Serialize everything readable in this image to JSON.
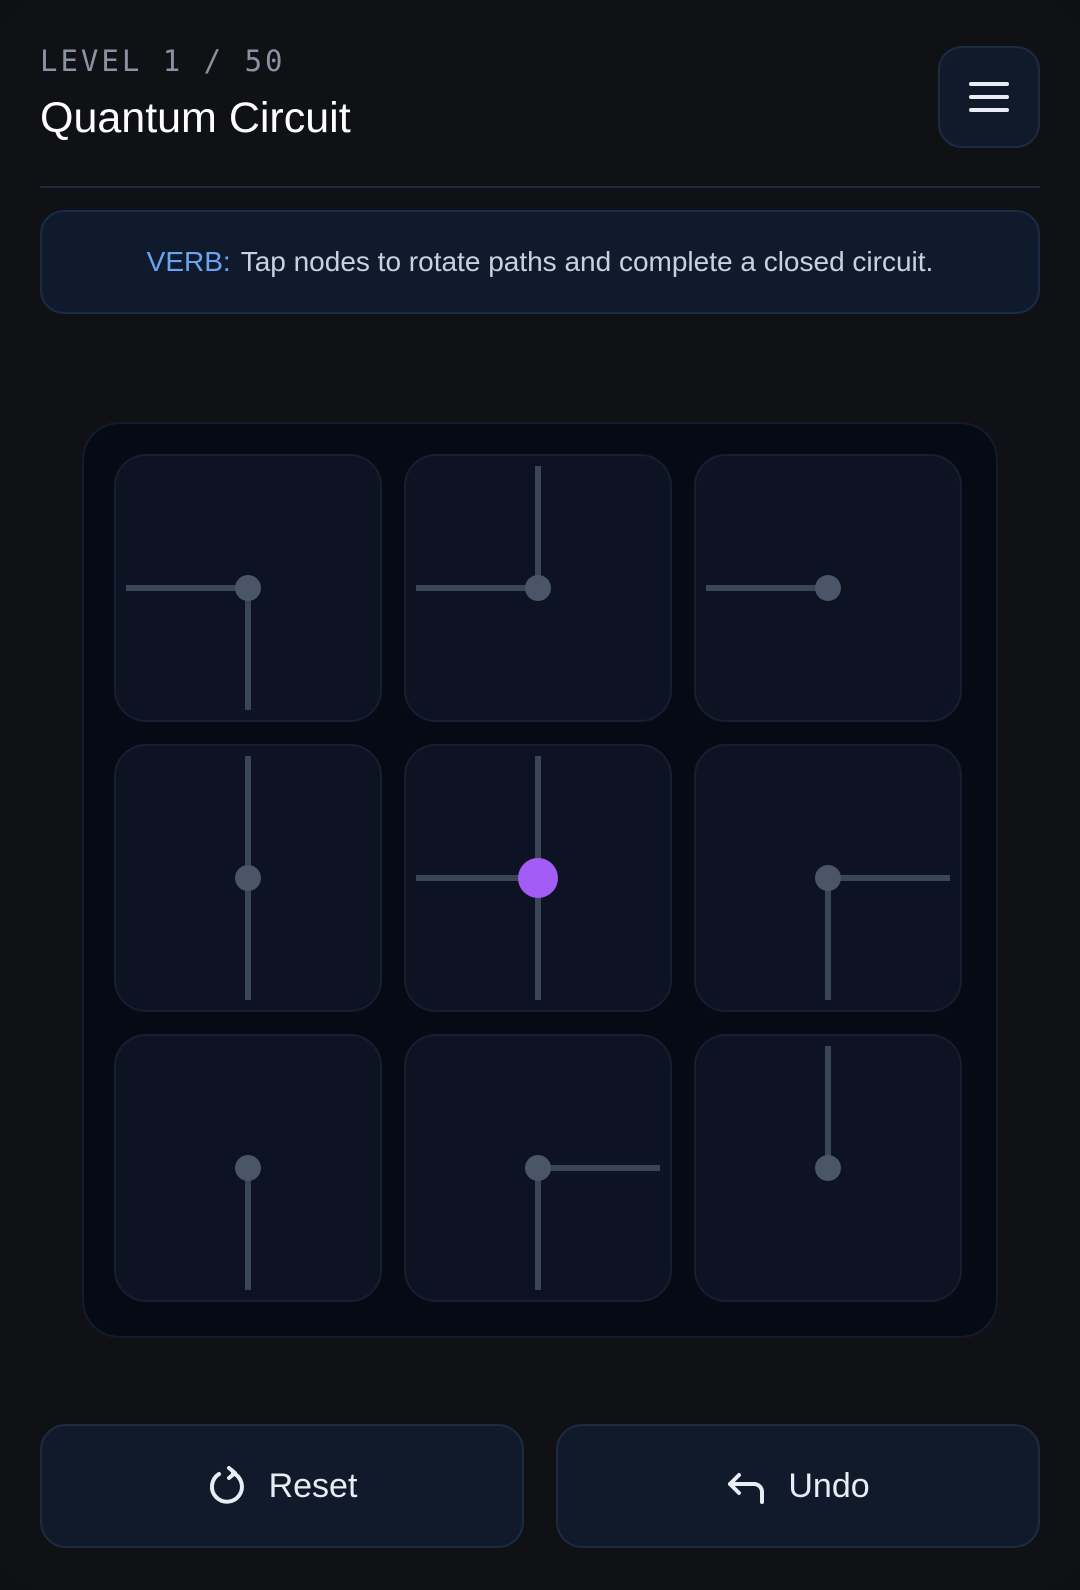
{
  "header": {
    "level_label": "LEVEL 1 / 50",
    "title": "Quantum Circuit",
    "menu_icon": "hamburger-menu-icon"
  },
  "instruction": {
    "verb_label": "VERB:",
    "text": "Tap nodes to rotate paths and complete a closed circuit."
  },
  "grid": {
    "rows": 3,
    "cols": 3,
    "tiles": [
      {
        "row": 0,
        "col": 0,
        "connections": [
          "left",
          "bottom"
        ],
        "active": false
      },
      {
        "row": 0,
        "col": 1,
        "connections": [
          "top",
          "left"
        ],
        "active": false
      },
      {
        "row": 0,
        "col": 2,
        "connections": [
          "left"
        ],
        "active": false
      },
      {
        "row": 1,
        "col": 0,
        "connections": [
          "top",
          "bottom"
        ],
        "active": false
      },
      {
        "row": 1,
        "col": 1,
        "connections": [
          "top",
          "left",
          "bottom"
        ],
        "active": true
      },
      {
        "row": 1,
        "col": 2,
        "connections": [
          "right",
          "bottom"
        ],
        "active": false
      },
      {
        "row": 2,
        "col": 0,
        "connections": [
          "bottom"
        ],
        "active": false
      },
      {
        "row": 2,
        "col": 1,
        "connections": [
          "right",
          "bottom"
        ],
        "active": false
      },
      {
        "row": 2,
        "col": 2,
        "connections": [
          "top"
        ],
        "active": false
      }
    ]
  },
  "controls": {
    "reset_label": "Reset",
    "reset_icon": "reset-rotate-icon",
    "undo_label": "Undo",
    "undo_icon": "undo-arrow-icon"
  },
  "colors": {
    "path": "#3a4558",
    "node": "#4a5568",
    "active_node": "#a35cf5",
    "verb_accent": "#6aa4f0"
  }
}
